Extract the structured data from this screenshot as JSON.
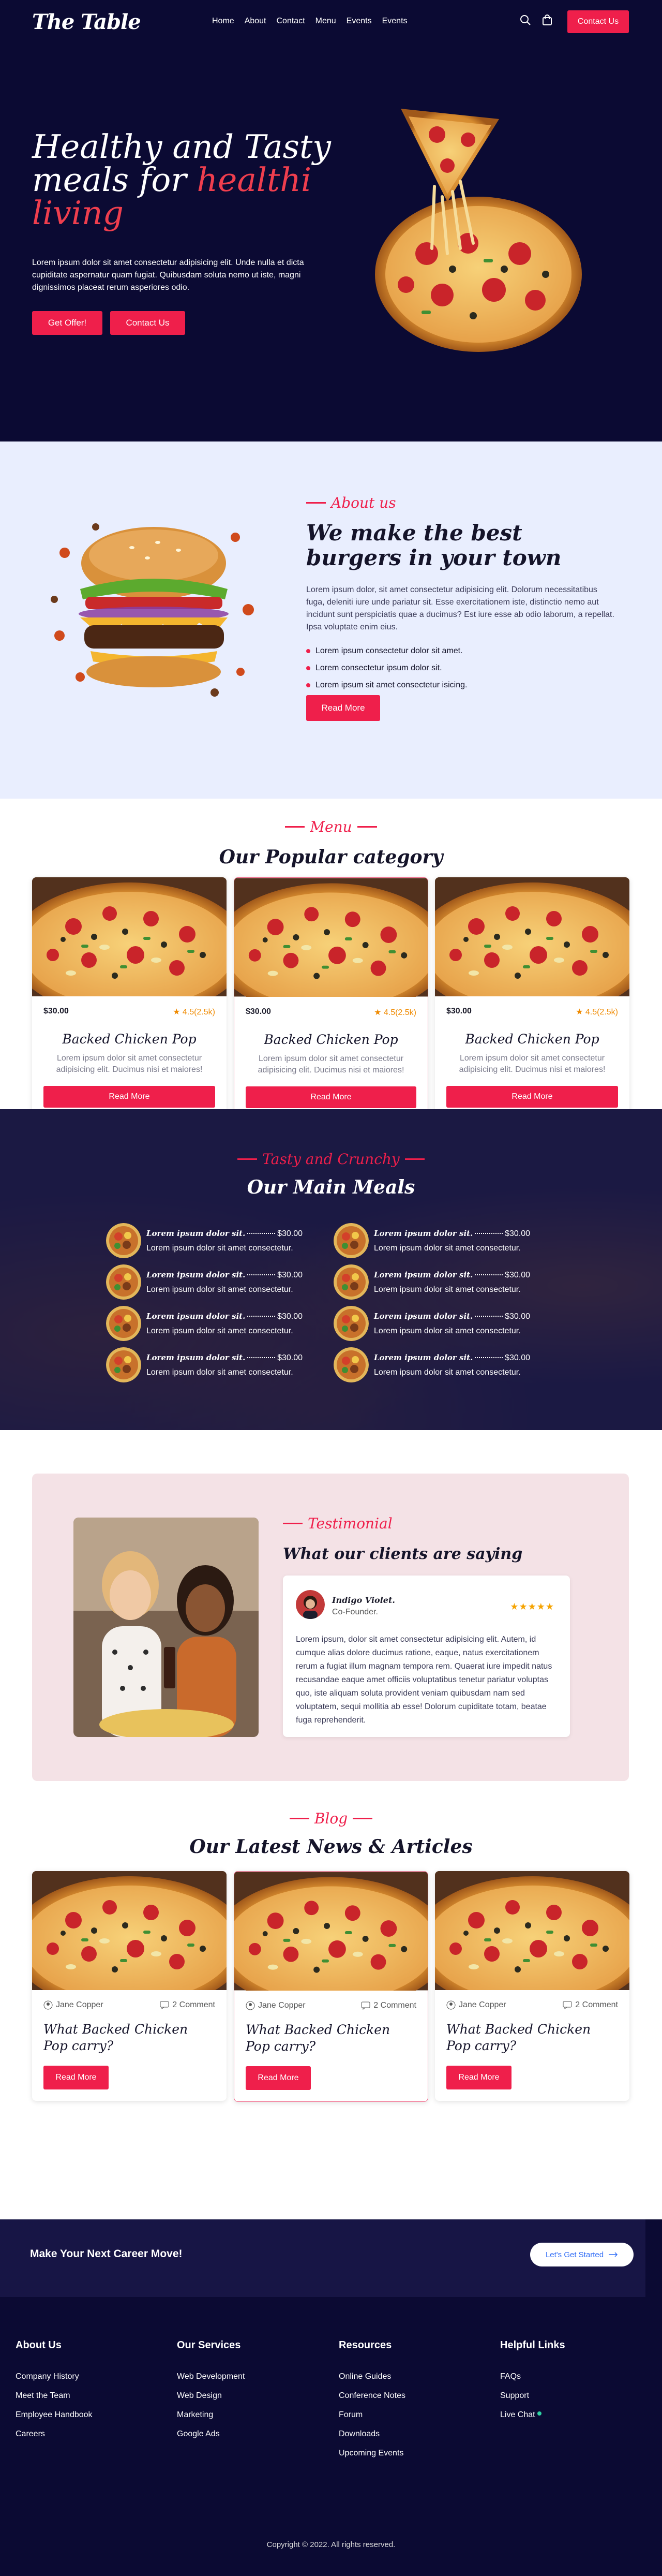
{
  "nav": {
    "logo": "The Table",
    "links": [
      "Home",
      "About",
      "Contact",
      "Menu",
      "Events",
      "Events"
    ],
    "contact_label": "Contact Us"
  },
  "hero": {
    "title_line1": "Healthy and Tasty",
    "title_line2_a": "meals for ",
    "title_line2_b": "healthi",
    "title_line3": "living",
    "text": "Lorem ipsum dolor sit amet consectetur adipisicing elit. Unde nulla et dicta cupiditate aspernatur quam fugiat. Quibusdam soluta nemo ut iste, magni dignissimos placeat rerum asperiores odio.",
    "btn_offer": "Get Offer!",
    "btn_contact": "Contact Us"
  },
  "about": {
    "tag": "About us",
    "title": "We make the best burgers in your town",
    "text": "Lorem ipsum dolor, sit amet consectetur adipisicing elit. Dolorum necessitatibus fuga, deleniti iure unde pariatur sit. Esse exercitationem iste, distinctio nemo aut incidunt sunt perspiciatis quae a ducimus? Est iure esse ab odio laborum, a repellat. Ipsa voluptate enim eius.",
    "list": [
      "Lorem ipsum consectetur dolor sit amet.",
      "Lorem consectetur ipsum dolor sit.",
      "Lorem ipsum sit amet consectetur isicing."
    ],
    "btn": "Read More"
  },
  "menu": {
    "tag": "Menu",
    "title": "Our Popular category",
    "cards": [
      {
        "price": "$30.00",
        "rating": "4.5(2.5k)",
        "title": "Backed Chicken Pop",
        "text": "Lorem ipsum dolor sit amet consectetur adipisicing elit. Ducimus nisi et maiores!",
        "btn": "Read More"
      },
      {
        "price": "$30.00",
        "rating": "4.5(2.5k)",
        "title": "Backed Chicken Pop",
        "text": "Lorem ipsum dolor sit amet consectetur adipisicing elit. Ducimus nisi et maiores!",
        "btn": "Read More"
      },
      {
        "price": "$30.00",
        "rating": "4.5(2.5k)",
        "title": "Backed Chicken Pop",
        "text": "Lorem ipsum dolor sit amet consectetur adipisicing elit. Ducimus nisi et maiores!",
        "btn": "Read More"
      }
    ]
  },
  "meals": {
    "tag": "Tasty and Crunchy",
    "title": "Our Main Meals",
    "items": [
      {
        "name": "Lorem ipsum dolor sit.",
        "price": "$30.00",
        "desc": "Lorem ipsum dolor sit amet consectetur."
      },
      {
        "name": "Lorem ipsum dolor sit.",
        "price": "$30.00",
        "desc": "Lorem ipsum dolor sit amet consectetur."
      },
      {
        "name": "Lorem ipsum dolor sit.",
        "price": "$30.00",
        "desc": "Lorem ipsum dolor sit amet consectetur."
      },
      {
        "name": "Lorem ipsum dolor sit.",
        "price": "$30.00",
        "desc": "Lorem ipsum dolor sit amet consectetur."
      },
      {
        "name": "Lorem ipsum dolor sit.",
        "price": "$30.00",
        "desc": "Lorem ipsum dolor sit amet consectetur."
      },
      {
        "name": "Lorem ipsum dolor sit.",
        "price": "$30.00",
        "desc": "Lorem ipsum dolor sit amet consectetur."
      },
      {
        "name": "Lorem ipsum dolor sit.",
        "price": "$30.00",
        "desc": "Lorem ipsum dolor sit amet consectetur."
      },
      {
        "name": "Lorem ipsum dolor sit.",
        "price": "$30.00",
        "desc": "Lorem ipsum dolor sit amet consectetur."
      }
    ]
  },
  "testimonial": {
    "tag": "Testimonial",
    "title": "What our clients are saying",
    "name": "Indigo Violet.",
    "role": "Co-Founder.",
    "stars": "★★★★★",
    "rating": 5,
    "text": "Lorem ipsum, dolor sit amet consectetur adipisicing elit. Autem, id cumque alias dolore ducimus ratione, eaque, natus exercitationem rerum a fugiat illum magnam tempora rem. Quaerat iure impedit natus recusandae eaque amet officiis voluptatibus tenetur pariatur voluptas quo, iste aliquam soluta provident veniam quibusdam nam sed voluptatem, sequi mollitia ab esse! Dolorum cupiditate totam, beatae fuga reprehenderit."
  },
  "blog": {
    "tag": "Blog",
    "title": "Our Latest News & Articles",
    "cards": [
      {
        "author": "Jane Copper",
        "comments": "2 Comment",
        "title": "What Backed Chicken Pop carry?",
        "btn": "Read More"
      },
      {
        "author": "Jane Copper",
        "comments": "2 Comment",
        "title": "What Backed Chicken Pop carry?",
        "btn": "Read More"
      },
      {
        "author": "Jane Copper",
        "comments": "2 Comment",
        "title": "What Backed Chicken Pop carry?",
        "btn": "Read More"
      }
    ]
  },
  "footer": {
    "career_title": "Make Your Next Career Move!",
    "career_btn": "Let's Get Started",
    "columns": [
      {
        "title": "About Us",
        "links": [
          "Company History",
          "Meet the Team",
          "Employee Handbook",
          "Careers"
        ]
      },
      {
        "title": "Our Services",
        "links": [
          "Web Development",
          "Web Design",
          "Marketing",
          "Google Ads"
        ]
      },
      {
        "title": "Resources",
        "links": [
          "Online Guides",
          "Conference Notes",
          "Forum",
          "Downloads",
          "Upcoming Events"
        ]
      },
      {
        "title": "Helpful Links",
        "links": [
          "FAQs",
          "Support",
          "Live Chat"
        ]
      }
    ],
    "copyright": "Copyright © 2022. All rights reserved."
  },
  "colors": {
    "accent": "#ef1f4b",
    "navy": "#0b0a33",
    "about_bg": "#e9eefe",
    "testimonial_bg": "#f4e2e6"
  }
}
